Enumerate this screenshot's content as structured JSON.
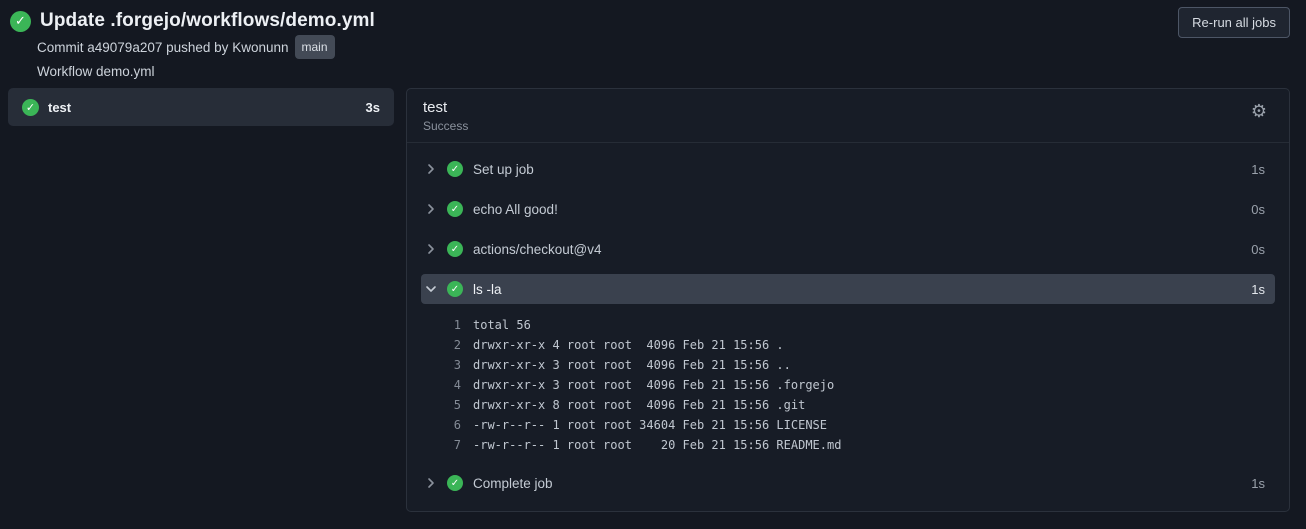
{
  "header": {
    "title": "Update .forgejo/workflows/demo.yml",
    "commit_line": {
      "prefix": "Commit",
      "sha": "a49079a207",
      "middle": "pushed by",
      "author": "Kwonunn",
      "branch": "main"
    },
    "workflow_line": "Workflow demo.yml",
    "rerun_button_label": "Re-run all jobs"
  },
  "sidebar": {
    "jobs": [
      {
        "name": "test",
        "duration": "3s",
        "status": "success"
      }
    ]
  },
  "panel": {
    "job_name": "test",
    "job_status": "Success",
    "steps": [
      {
        "label": "Set up job",
        "duration": "1s",
        "expanded": false
      },
      {
        "label": "echo All good!",
        "duration": "0s",
        "expanded": false
      },
      {
        "label": "actions/checkout@v4",
        "duration": "0s",
        "expanded": false
      },
      {
        "label": "ls -la",
        "duration": "1s",
        "expanded": true,
        "log_lines": [
          {
            "num": "1",
            "text": "total 56"
          },
          {
            "num": "2",
            "text": "drwxr-xr-x 4 root root  4096 Feb 21 15:56 ."
          },
          {
            "num": "3",
            "text": "drwxr-xr-x 3 root root  4096 Feb 21 15:56 .."
          },
          {
            "num": "4",
            "text": "drwxr-xr-x 3 root root  4096 Feb 21 15:56 .forgejo"
          },
          {
            "num": "5",
            "text": "drwxr-xr-x 8 root root  4096 Feb 21 15:56 .git"
          },
          {
            "num": "6",
            "text": "-rw-r--r-- 1 root root 34604 Feb 21 15:56 LICENSE"
          },
          {
            "num": "7",
            "text": "-rw-r--r-- 1 root root    20 Feb 21 15:56 README.md"
          }
        ]
      },
      {
        "label": "Complete job",
        "duration": "1s",
        "expanded": false
      }
    ]
  },
  "icons": {
    "check": "✓",
    "gear": "⚙"
  },
  "colors": {
    "success_green": "#3bb557",
    "page_background": "#141821",
    "panel_background": "#171c26",
    "expanded_row_background": "#3a414e",
    "selected_job_background": "#272d38"
  }
}
